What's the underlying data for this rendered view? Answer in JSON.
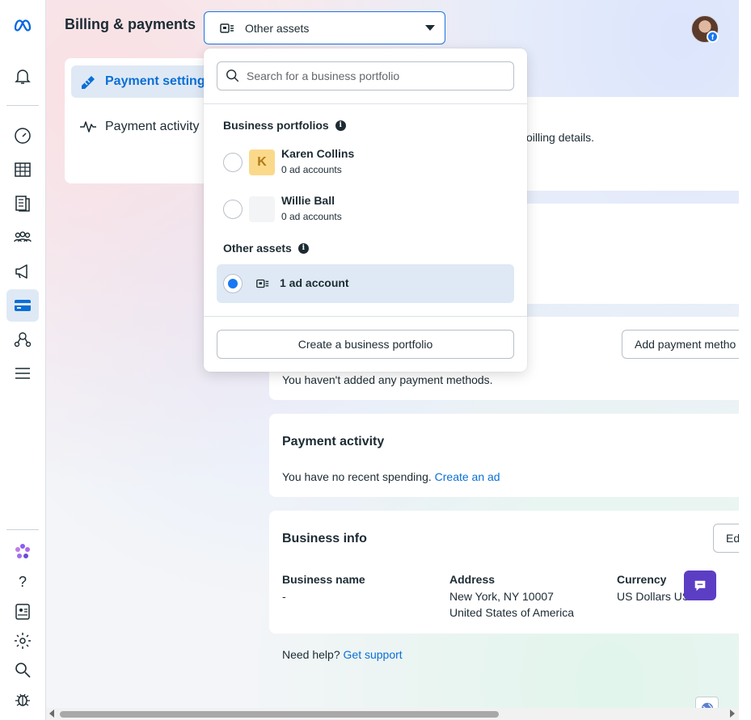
{
  "header": {
    "title": "Billing & payments",
    "asset_selector": "Other assets"
  },
  "nav": {
    "items": [
      {
        "label": "Payment settings",
        "active": true
      },
      {
        "label": "Payment activity",
        "active": false
      }
    ]
  },
  "dropdown": {
    "search_placeholder": "Search for a business portfolio",
    "portfolios_heading": "Business portfolios",
    "portfolios": [
      {
        "initial": "K",
        "name": "Karen Collins",
        "sub": "0 ad accounts"
      },
      {
        "initial": "",
        "name": "Willie Ball",
        "sub": "0 ad accounts"
      }
    ],
    "other_heading": "Other assets",
    "other_item": "1 ad account",
    "create_button": "Create a business portfolio"
  },
  "cards": {
    "partial_text": "oilling details.",
    "payment_methods": {
      "add_button": "Add payment metho",
      "empty_text": "You haven't added any payment methods."
    },
    "payment_activity": {
      "title": "Payment activity",
      "text": "You have no recent spending.",
      "link": "Create an ad"
    },
    "business_info": {
      "title": "Business info",
      "edit_button": "Ed",
      "fields": [
        {
          "label": "Business name",
          "value": "-",
          "value2": ""
        },
        {
          "label": "Address",
          "value": "New York, NY 10007",
          "value2": "United States of America"
        },
        {
          "label": "Currency",
          "value": "US Dollars US",
          "value2": ""
        }
      ]
    }
  },
  "help": {
    "text": "Need help?",
    "link": "Get support"
  },
  "colors": {
    "accent": "#1877f2",
    "link": "#0a6fd6",
    "chat": "#5b3ec4"
  }
}
